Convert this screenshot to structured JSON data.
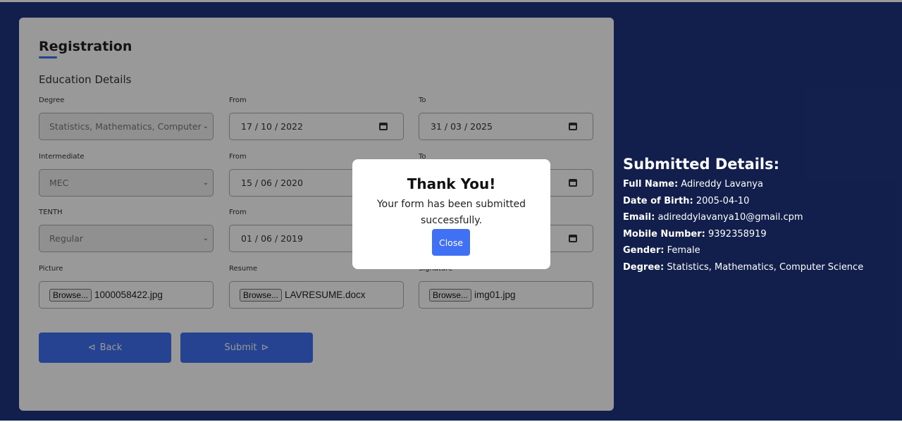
{
  "form": {
    "title": "Registration",
    "section": "Education Details",
    "rows": [
      {
        "label": "Degree",
        "value": "Statistics, Mathematics, Computer Science",
        "from_label": "From",
        "from": "17 / 10 / 2022",
        "to_label": "To",
        "to": "31 / 03 / 2025"
      },
      {
        "label": "Intermediate",
        "value": "MEC",
        "from_label": "From",
        "from": "15 / 06 / 2020",
        "to_label": "To",
        "to": ""
      },
      {
        "label": "TENTH",
        "value": "Regular",
        "from_label": "From",
        "from": "01 / 06 / 2019",
        "to_label": "",
        "to": ""
      }
    ],
    "uploads": [
      {
        "label": "Picture",
        "button": "Browse...",
        "file": "1000058422.jpg"
      },
      {
        "label": "Resume",
        "button": "Browse...",
        "file": "LAVRESUME.docx"
      },
      {
        "label": "Signature",
        "button": "Browse...",
        "file": "img01.jpg"
      }
    ],
    "back_label": "Back",
    "submit_label": "Submit",
    "back_icon": "back-arrow-icon",
    "submit_icon": "forward-arrow-icon",
    "accent": "#4070f4"
  },
  "modal": {
    "title": "Thank You!",
    "message": "Your form has been submitted successfully.",
    "close_label": "Close"
  },
  "summary": {
    "title": "Submitted Details:",
    "items": [
      {
        "key": "Full Name:",
        "value": "Adireddy Lavanya"
      },
      {
        "key": "Date of Birth:",
        "value": "2005-04-10"
      },
      {
        "key": "Email:",
        "value": "adireddylavanya10@gmail.cpm"
      },
      {
        "key": "Mobile Number:",
        "value": "9392358919"
      },
      {
        "key": "Gender:",
        "value": "Female"
      },
      {
        "key": "Degree:",
        "value": "Statistics, Mathematics, Computer Science"
      }
    ]
  },
  "colors": {
    "background": "#1f3580",
    "accent": "#4070f4"
  }
}
